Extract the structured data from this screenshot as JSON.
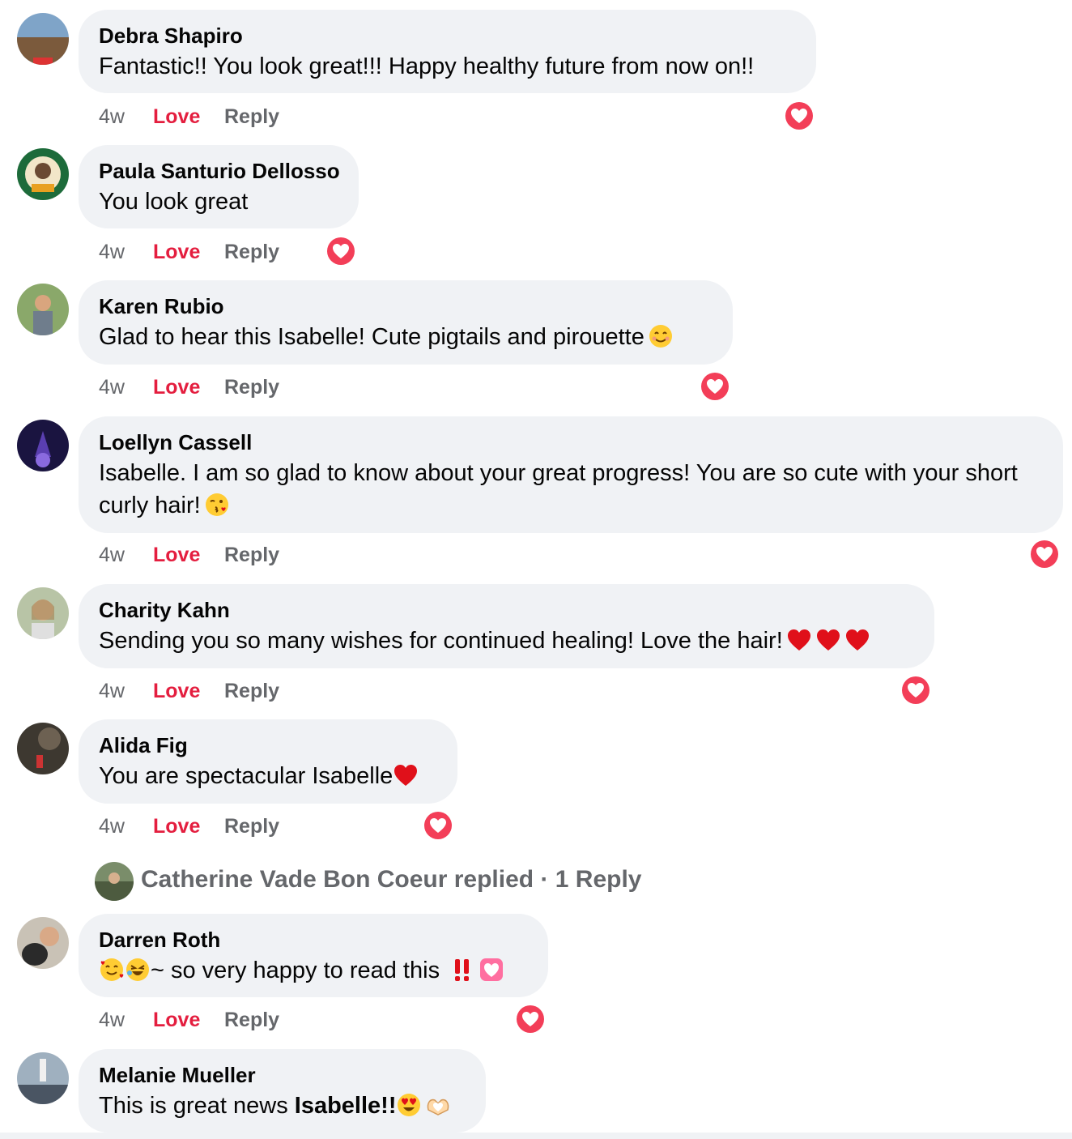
{
  "comments": [
    {
      "author": "Debra Shapiro",
      "text": "Fantastic!! You look great!!! Happy healthy future from now on!!",
      "time": "4w",
      "love_label": "Love",
      "reply_label": "Reply"
    },
    {
      "author": "Paula Santurio Dellosso",
      "text": "You look great",
      "time": "4w",
      "love_label": "Love",
      "reply_label": "Reply"
    },
    {
      "author": "Karen Rubio",
      "text": "Glad to hear this Isabelle! Cute pigtails and pirouette",
      "time": "4w",
      "love_label": "Love",
      "reply_label": "Reply"
    },
    {
      "author": "Loellyn Cassell",
      "text": "Isabelle. I am so glad to know about your great progress! You are so cute with your short curly hair!",
      "time": "4w",
      "love_label": "Love",
      "reply_label": "Reply"
    },
    {
      "author": "Charity Kahn",
      "text": "Sending you so many wishes for continued healing! Love the hair!",
      "time": "4w",
      "love_label": "Love",
      "reply_label": "Reply"
    },
    {
      "author": "Alida Fig",
      "text": "You are spectacular Isabelle",
      "time": "4w",
      "love_label": "Love",
      "reply_label": "Reply"
    },
    {
      "author": "Darren Roth",
      "text": "~ so very happy to read this",
      "time": "4w",
      "love_label": "Love",
      "reply_label": "Reply"
    },
    {
      "author": "Melanie Mueller",
      "text_prefix": "This is great news ",
      "text_bold": "Isabelle!!"
    }
  ],
  "replies_summary": "Catherine Vade Bon Coeur replied · 1 Reply",
  "colors": {
    "love": "#e41e3f",
    "muted": "#65676b",
    "bubble": "#f0f2f5",
    "reaction": "#f33e58"
  },
  "icons": [
    "love-reaction-icon",
    "smiling-face-icon",
    "kissing-face-icon",
    "red-heart-icon",
    "smiling-hearts-face-icon",
    "rofl-face-icon",
    "double-exclamation-icon",
    "heart-box-icon",
    "heart-eyes-face-icon",
    "heart-hands-icon"
  ]
}
